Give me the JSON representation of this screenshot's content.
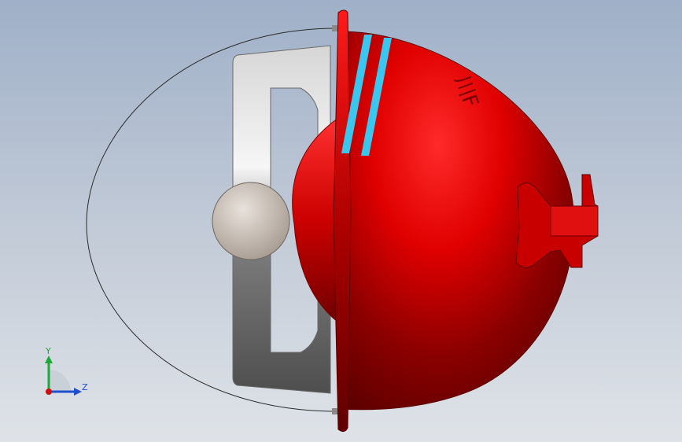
{
  "viewport": {
    "background_top": "#9fb0c8",
    "background_bottom": "#dfe3e8"
  },
  "model": {
    "body_color": "#e00000",
    "stripe_color": "#39c6ef",
    "handle_color": "#d8d8d8",
    "knob_color": "#cbbfb6",
    "embossed_text": "川F"
  },
  "triad": {
    "y_label": "Y",
    "z_label": "Z",
    "y_color": "#1fa83a",
    "z_color": "#1f4fd1",
    "origin_color": "#d01010"
  }
}
